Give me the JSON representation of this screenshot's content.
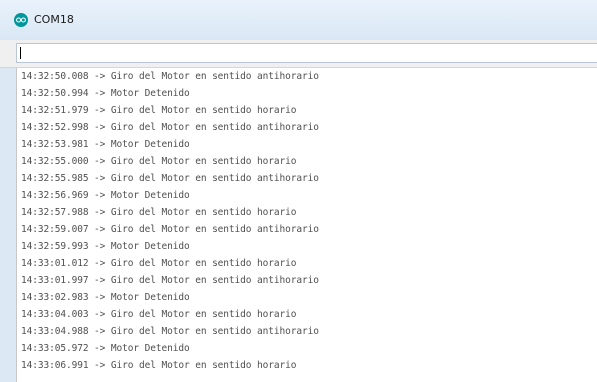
{
  "window": {
    "title": "COM18",
    "icon": "arduino-icon",
    "accent_color": "#00979c"
  },
  "send_bar": {
    "input_value": ""
  },
  "serial_log": [
    "14:32:50.008 -> Giro del Motor en sentido antihorario",
    "14:32:50.994 -> Motor Detenido",
    "14:32:51.979 -> Giro del Motor en sentido horario",
    "14:32:52.998 -> Giro del Motor en sentido antihorario",
    "14:32:53.981 -> Motor Detenido",
    "14:32:55.000 -> Giro del Motor en sentido horario",
    "14:32:55.985 -> Giro del Motor en sentido antihorario",
    "14:32:56.969 -> Motor Detenido",
    "14:32:57.988 -> Giro del Motor en sentido horario",
    "14:32:59.007 -> Giro del Motor en sentido antihorario",
    "14:32:59.993 -> Motor Detenido",
    "14:33:01.012 -> Giro del Motor en sentido horario",
    "14:33:01.997 -> Giro del Motor en sentido antihorario",
    "14:33:02.983 -> Motor Detenido",
    "14:33:04.003 -> Giro del Motor en sentido horario",
    "14:33:04.988 -> Giro del Motor en sentido antihorario",
    "14:33:05.972 -> Motor Detenido",
    "14:33:06.991 -> Giro del Motor en sentido horario"
  ]
}
